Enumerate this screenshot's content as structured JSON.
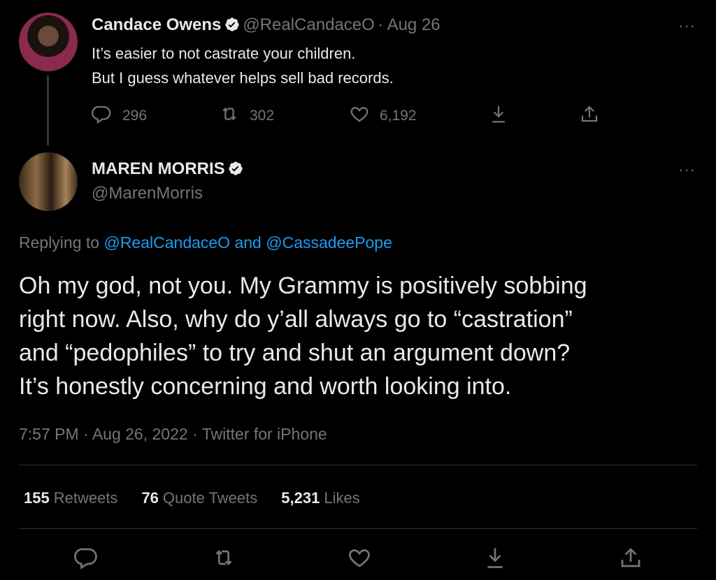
{
  "tweet1": {
    "name": "Candace Owens",
    "handle": "@RealCandaceO",
    "date": "· Aug 26",
    "line1": "It’s easier to not castrate your children.",
    "line2": "But I guess whatever helps sell bad records.",
    "replies": "296",
    "retweets": "302",
    "likes": "6,192",
    "more": "···"
  },
  "tweet2": {
    "name": "MAREN MORRIS",
    "handle": "@MarenMorris",
    "more": "···",
    "replying_prefix": "Replying to",
    "mention1": "@RealCandaceO",
    "and": "and",
    "mention2": "@CassadeePope",
    "line1": "Oh my god, not you. My Grammy is positively sobbing",
    "line2": "right now. Also, why do y’all always go to “castration”",
    "line3": "and “pedophiles” to try and shut an argument down?",
    "line4": "It’s honestly concerning and worth looking into.",
    "meta": "7:57 PM · Aug 26, 2022 · Twitter for iPhone",
    "retweet_count": "155",
    "retweet_label": "Retweets",
    "quote_count": "76",
    "quote_label": "Quote Tweets",
    "like_count": "5,231",
    "like_label": "Likes"
  },
  "colors": {
    "background": "#000000",
    "text": "#e7e9ea",
    "secondary": "#71767b",
    "link": "#1d9bf0"
  }
}
